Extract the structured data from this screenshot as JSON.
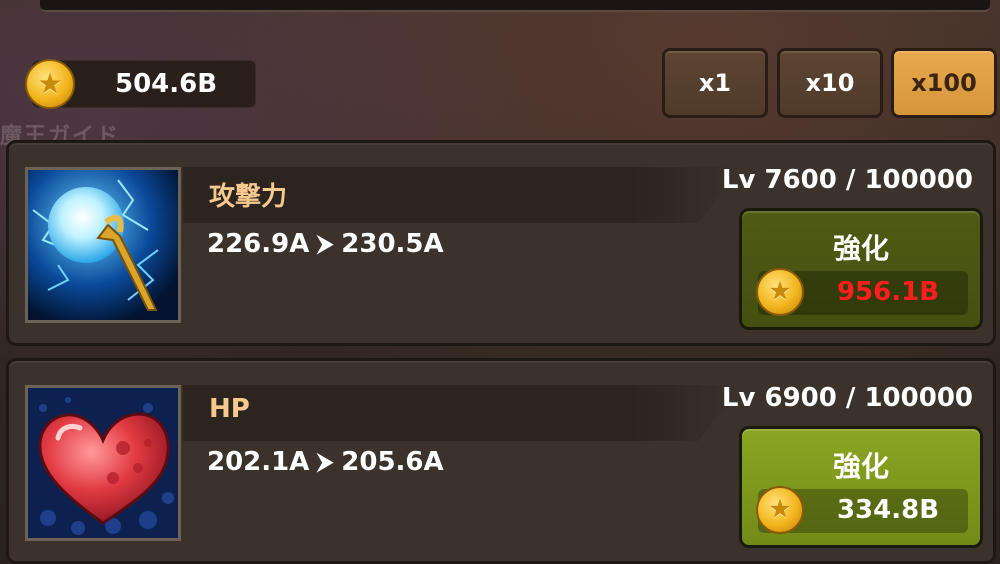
{
  "currency": {
    "amount": "504.6B",
    "icon": "gold-coin-icon"
  },
  "ghost_text": "魔王ガイド",
  "multipliers": [
    {
      "label": "x1",
      "selected": false
    },
    {
      "label": "x10",
      "selected": false
    },
    {
      "label": "x100",
      "selected": true
    }
  ],
  "upgrades": [
    {
      "icon": "lightning-staff-icon",
      "name": "攻撃力",
      "current": "226.9A",
      "next": "230.5A",
      "level_text": "Lv 7600 / 100000",
      "button_label": "強化",
      "cost": "956.1B",
      "affordable": false
    },
    {
      "icon": "heart-icon",
      "name": "HP",
      "current": "202.1A",
      "next": "205.6A",
      "level_text": "Lv 6900 / 100000",
      "button_label": "強化",
      "cost": "334.8B",
      "affordable": true
    }
  ],
  "colors": {
    "selected_multiplier": "#e8a94e",
    "insufficient_cost": "#ff1d1d",
    "button_enabled": "#8aa522",
    "button_disabled": "#4f5b13",
    "stat_name": "#f7c98e"
  }
}
